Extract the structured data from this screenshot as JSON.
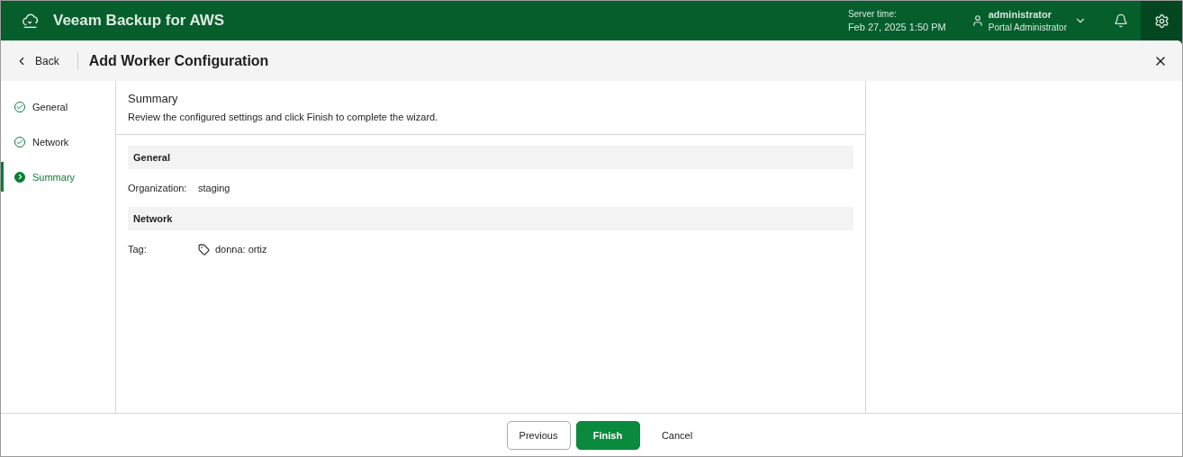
{
  "app": {
    "title": "Veeam Backup for AWS",
    "server_time_label": "Server time:",
    "server_time": "Feb 27, 2025 1:50 PM",
    "user_name": "administrator",
    "user_role": "Portal Administrator"
  },
  "toolbar": {
    "back": "Back",
    "title": "Add Worker Configuration"
  },
  "steps": [
    {
      "label": "General",
      "selected": false,
      "completed": true
    },
    {
      "label": "Network",
      "selected": false,
      "completed": true
    },
    {
      "label": "Summary",
      "selected": true,
      "completed": false
    }
  ],
  "page": {
    "title": "Summary",
    "description": "Review the configured settings and click Finish to complete the wizard."
  },
  "sections": [
    {
      "title": "General",
      "rows": [
        {
          "label": "Organization:",
          "value": "staging",
          "kind": "text"
        }
      ]
    },
    {
      "title": "Network",
      "rows": [
        {
          "label": "Tag:",
          "value": "donna: ortiz",
          "kind": "tag"
        }
      ]
    }
  ],
  "buttons": [
    {
      "label": "Previous",
      "kind": "secondary"
    },
    {
      "label": "Finish",
      "kind": "primary"
    },
    {
      "label": "Cancel",
      "kind": "plain"
    }
  ]
}
